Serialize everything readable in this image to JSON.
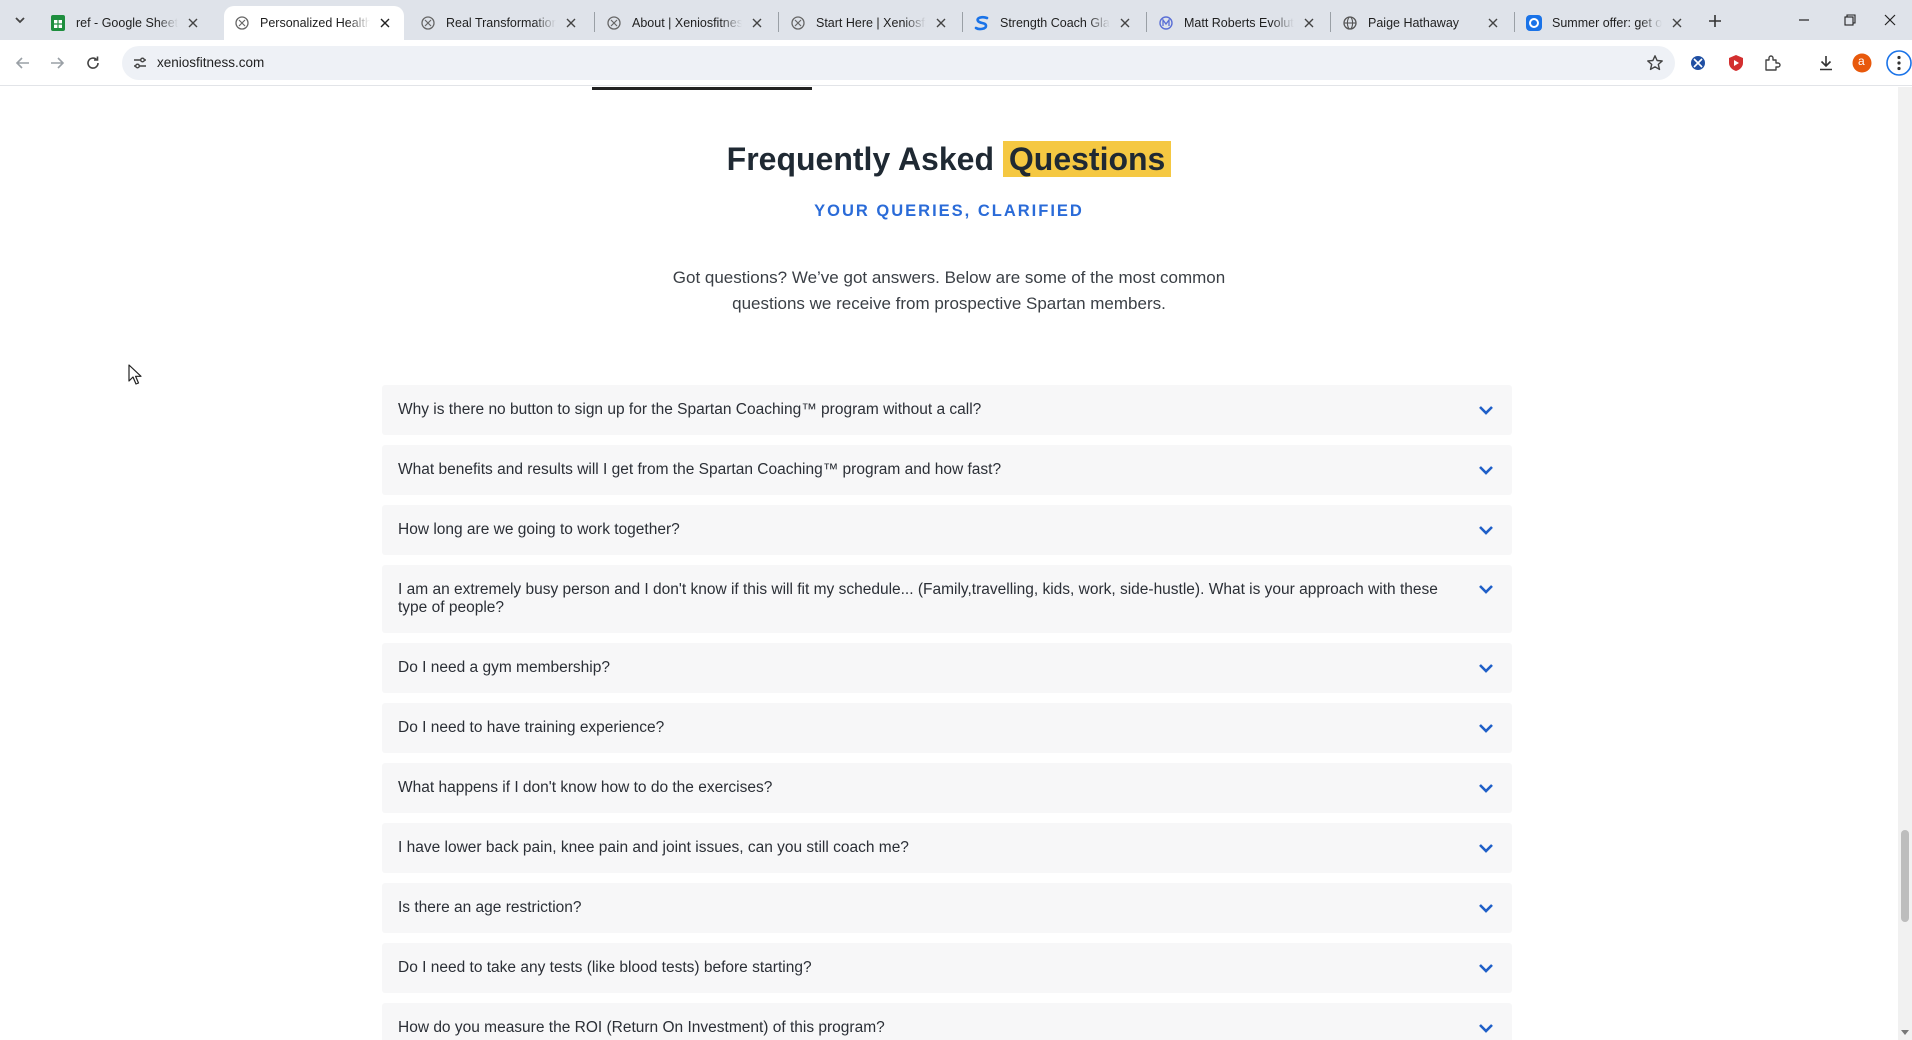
{
  "browser": {
    "tabs": [
      {
        "title": "ref - Google Sheets",
        "favicon": "sheets-icon",
        "active": false
      },
      {
        "title": "Personalized Health C",
        "favicon": "xenios-icon",
        "active": true
      },
      {
        "title": "Real Transformations",
        "favicon": "xenios-icon",
        "active": false
      },
      {
        "title": "About | Xeniosfitness",
        "favicon": "xenios-icon",
        "active": false
      },
      {
        "title": "Start Here | Xeniosfitn",
        "favicon": "xenios-icon",
        "active": false
      },
      {
        "title": "Strength Coach Glasg",
        "favicon": "s-brand-icon",
        "active": false
      },
      {
        "title": "Matt Roberts Evolutio",
        "favicon": "m-brand-icon",
        "active": false
      },
      {
        "title": "Paige Hathaway",
        "favicon": "globe-icon",
        "active": false
      },
      {
        "title": "Summer offer: get on",
        "favicon": "o-brand-icon",
        "active": false
      }
    ],
    "url": "xeniosfitness.com",
    "profile_initial": "a",
    "colors": {
      "sheets_green": "#1e8e3e",
      "brand_blue": "#1a73e8",
      "profile_orange": "#e8590c",
      "ext_red": "#d32f2f"
    }
  },
  "faq": {
    "title_main": "Frequently Asked ",
    "title_highlight": "Questions",
    "subtitle": "YOUR QUERIES, CLARIFIED",
    "intro": "Got questions? We’ve got answers. Below are some of the most common questions we receive from prospective Spartan members.",
    "items": [
      "Why is there no button to sign up for the Spartan Coaching™ program without a call?",
      "What benefits and results will I get from the Spartan Coaching™ program and how fast?",
      "How long are we going to work together?",
      "I am an extremely busy person and I don't know if this will fit my schedule... (Family,travelling, kids, work, side-hustle). What is your approach with these type of people?",
      "Do I need a gym membership?",
      "Do I need to have training experience?",
      "What happens if I don't know how to do the exercises?",
      "I have lower back pain, knee pain and joint issues, can you still coach me?",
      "Is there an age restriction?",
      "Do I need to take any tests (like blood tests) before starting?",
      "How do you measure the ROI (Return On Investment) of this program?"
    ],
    "colors": {
      "highlight": "#f5c842",
      "accent_blue": "#2a6bd8",
      "chevron": "#1f5fc8",
      "item_bg": "#f7f7f8"
    }
  }
}
